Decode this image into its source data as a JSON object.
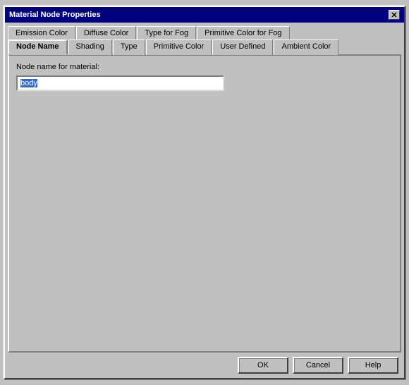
{
  "window": {
    "title": "Material Node Properties",
    "close_label": "✕"
  },
  "tabs_row1": [
    {
      "id": "emission-color",
      "label": "Emission Color",
      "active": false
    },
    {
      "id": "diffuse-color",
      "label": "Diffuse Color",
      "active": false
    },
    {
      "id": "type-for-fog",
      "label": "Type for Fog",
      "active": false
    },
    {
      "id": "primitive-color-for-fog",
      "label": "Primitive Color for Fog",
      "active": false
    }
  ],
  "tabs_row2": [
    {
      "id": "node-name",
      "label": "Node Name",
      "active": true
    },
    {
      "id": "shading",
      "label": "Shading",
      "active": false
    },
    {
      "id": "type",
      "label": "Type",
      "active": false
    },
    {
      "id": "primitive-color",
      "label": "Primitive Color",
      "active": false
    },
    {
      "id": "user-defined",
      "label": "User Defined",
      "active": false
    },
    {
      "id": "ambient-color",
      "label": "Ambient Color",
      "active": false
    }
  ],
  "panel": {
    "label": "Node name for material:",
    "input_value": "body",
    "input_placeholder": ""
  },
  "buttons": {
    "ok_label": "OK",
    "cancel_label": "Cancel",
    "help_label": "Help"
  }
}
